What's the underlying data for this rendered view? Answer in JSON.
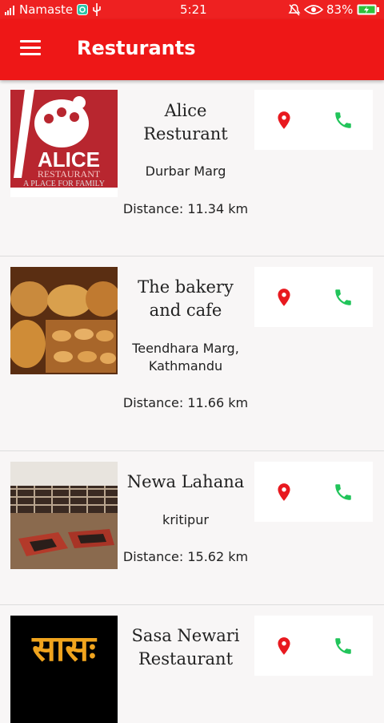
{
  "status_bar": {
    "carrier": "Namaste",
    "time": "5:21",
    "battery": "83%"
  },
  "app_bar": {
    "title": "Resturants"
  },
  "restaurants": [
    {
      "name": "Alice Resturant",
      "address": "Durbar Marg",
      "distance": "Distance: 11.34 km"
    },
    {
      "name": "The bakery and cafe",
      "address": "Teendhara Marg, Kathmandu",
      "distance": "Distance: 11.66 km"
    },
    {
      "name": "Newa Lahana",
      "address": "kritipur",
      "distance": "Distance: 15.62 km"
    },
    {
      "name": "Sasa Newari Restaurant",
      "address": "",
      "distance": ""
    }
  ],
  "logo_text": {
    "alice_big": "ALICE",
    "alice_sub": "RESTAURANT",
    "alice_tag": "A PLACE FOR FAMILY",
    "sasa": "सासः"
  },
  "colors": {
    "primary": "#ee1717",
    "location": "#e8191f",
    "call": "#21c45a"
  },
  "icons": {
    "menu": "menu-icon",
    "location": "location-pin-icon",
    "call": "phone-icon"
  }
}
